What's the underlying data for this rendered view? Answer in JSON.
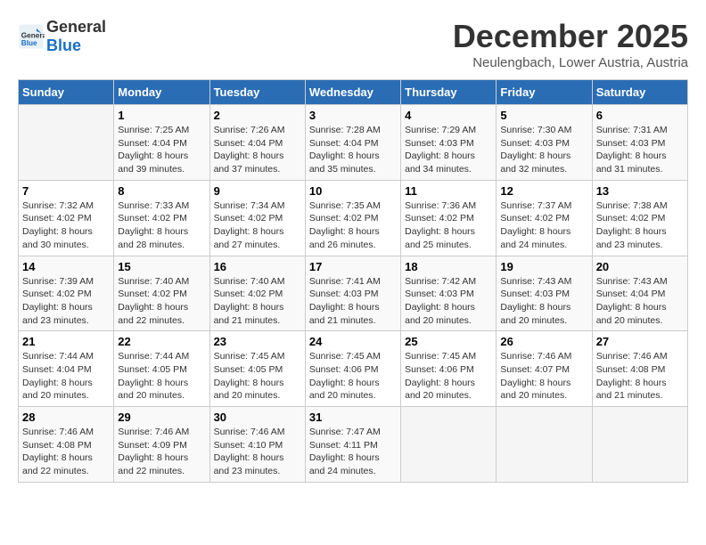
{
  "header": {
    "logo_general": "General",
    "logo_blue": "Blue",
    "month_title": "December 2025",
    "location": "Neulengbach, Lower Austria, Austria"
  },
  "days_of_week": [
    "Sunday",
    "Monday",
    "Tuesday",
    "Wednesday",
    "Thursday",
    "Friday",
    "Saturday"
  ],
  "weeks": [
    [
      {
        "day": "",
        "sunrise": "",
        "sunset": "",
        "daylight": ""
      },
      {
        "day": "1",
        "sunrise": "Sunrise: 7:25 AM",
        "sunset": "Sunset: 4:04 PM",
        "daylight": "Daylight: 8 hours and 39 minutes."
      },
      {
        "day": "2",
        "sunrise": "Sunrise: 7:26 AM",
        "sunset": "Sunset: 4:04 PM",
        "daylight": "Daylight: 8 hours and 37 minutes."
      },
      {
        "day": "3",
        "sunrise": "Sunrise: 7:28 AM",
        "sunset": "Sunset: 4:04 PM",
        "daylight": "Daylight: 8 hours and 35 minutes."
      },
      {
        "day": "4",
        "sunrise": "Sunrise: 7:29 AM",
        "sunset": "Sunset: 4:03 PM",
        "daylight": "Daylight: 8 hours and 34 minutes."
      },
      {
        "day": "5",
        "sunrise": "Sunrise: 7:30 AM",
        "sunset": "Sunset: 4:03 PM",
        "daylight": "Daylight: 8 hours and 32 minutes."
      },
      {
        "day": "6",
        "sunrise": "Sunrise: 7:31 AM",
        "sunset": "Sunset: 4:03 PM",
        "daylight": "Daylight: 8 hours and 31 minutes."
      }
    ],
    [
      {
        "day": "7",
        "sunrise": "Sunrise: 7:32 AM",
        "sunset": "Sunset: 4:02 PM",
        "daylight": "Daylight: 8 hours and 30 minutes."
      },
      {
        "day": "8",
        "sunrise": "Sunrise: 7:33 AM",
        "sunset": "Sunset: 4:02 PM",
        "daylight": "Daylight: 8 hours and 28 minutes."
      },
      {
        "day": "9",
        "sunrise": "Sunrise: 7:34 AM",
        "sunset": "Sunset: 4:02 PM",
        "daylight": "Daylight: 8 hours and 27 minutes."
      },
      {
        "day": "10",
        "sunrise": "Sunrise: 7:35 AM",
        "sunset": "Sunset: 4:02 PM",
        "daylight": "Daylight: 8 hours and 26 minutes."
      },
      {
        "day": "11",
        "sunrise": "Sunrise: 7:36 AM",
        "sunset": "Sunset: 4:02 PM",
        "daylight": "Daylight: 8 hours and 25 minutes."
      },
      {
        "day": "12",
        "sunrise": "Sunrise: 7:37 AM",
        "sunset": "Sunset: 4:02 PM",
        "daylight": "Daylight: 8 hours and 24 minutes."
      },
      {
        "day": "13",
        "sunrise": "Sunrise: 7:38 AM",
        "sunset": "Sunset: 4:02 PM",
        "daylight": "Daylight: 8 hours and 23 minutes."
      }
    ],
    [
      {
        "day": "14",
        "sunrise": "Sunrise: 7:39 AM",
        "sunset": "Sunset: 4:02 PM",
        "daylight": "Daylight: 8 hours and 23 minutes."
      },
      {
        "day": "15",
        "sunrise": "Sunrise: 7:40 AM",
        "sunset": "Sunset: 4:02 PM",
        "daylight": "Daylight: 8 hours and 22 minutes."
      },
      {
        "day": "16",
        "sunrise": "Sunrise: 7:40 AM",
        "sunset": "Sunset: 4:02 PM",
        "daylight": "Daylight: 8 hours and 21 minutes."
      },
      {
        "day": "17",
        "sunrise": "Sunrise: 7:41 AM",
        "sunset": "Sunset: 4:03 PM",
        "daylight": "Daylight: 8 hours and 21 minutes."
      },
      {
        "day": "18",
        "sunrise": "Sunrise: 7:42 AM",
        "sunset": "Sunset: 4:03 PM",
        "daylight": "Daylight: 8 hours and 20 minutes."
      },
      {
        "day": "19",
        "sunrise": "Sunrise: 7:43 AM",
        "sunset": "Sunset: 4:03 PM",
        "daylight": "Daylight: 8 hours and 20 minutes."
      },
      {
        "day": "20",
        "sunrise": "Sunrise: 7:43 AM",
        "sunset": "Sunset: 4:04 PM",
        "daylight": "Daylight: 8 hours and 20 minutes."
      }
    ],
    [
      {
        "day": "21",
        "sunrise": "Sunrise: 7:44 AM",
        "sunset": "Sunset: 4:04 PM",
        "daylight": "Daylight: 8 hours and 20 minutes."
      },
      {
        "day": "22",
        "sunrise": "Sunrise: 7:44 AM",
        "sunset": "Sunset: 4:05 PM",
        "daylight": "Daylight: 8 hours and 20 minutes."
      },
      {
        "day": "23",
        "sunrise": "Sunrise: 7:45 AM",
        "sunset": "Sunset: 4:05 PM",
        "daylight": "Daylight: 8 hours and 20 minutes."
      },
      {
        "day": "24",
        "sunrise": "Sunrise: 7:45 AM",
        "sunset": "Sunset: 4:06 PM",
        "daylight": "Daylight: 8 hours and 20 minutes."
      },
      {
        "day": "25",
        "sunrise": "Sunrise: 7:45 AM",
        "sunset": "Sunset: 4:06 PM",
        "daylight": "Daylight: 8 hours and 20 minutes."
      },
      {
        "day": "26",
        "sunrise": "Sunrise: 7:46 AM",
        "sunset": "Sunset: 4:07 PM",
        "daylight": "Daylight: 8 hours and 20 minutes."
      },
      {
        "day": "27",
        "sunrise": "Sunrise: 7:46 AM",
        "sunset": "Sunset: 4:08 PM",
        "daylight": "Daylight: 8 hours and 21 minutes."
      }
    ],
    [
      {
        "day": "28",
        "sunrise": "Sunrise: 7:46 AM",
        "sunset": "Sunset: 4:08 PM",
        "daylight": "Daylight: 8 hours and 22 minutes."
      },
      {
        "day": "29",
        "sunrise": "Sunrise: 7:46 AM",
        "sunset": "Sunset: 4:09 PM",
        "daylight": "Daylight: 8 hours and 22 minutes."
      },
      {
        "day": "30",
        "sunrise": "Sunrise: 7:46 AM",
        "sunset": "Sunset: 4:10 PM",
        "daylight": "Daylight: 8 hours and 23 minutes."
      },
      {
        "day": "31",
        "sunrise": "Sunrise: 7:47 AM",
        "sunset": "Sunset: 4:11 PM",
        "daylight": "Daylight: 8 hours and 24 minutes."
      },
      {
        "day": "",
        "sunrise": "",
        "sunset": "",
        "daylight": ""
      },
      {
        "day": "",
        "sunrise": "",
        "sunset": "",
        "daylight": ""
      },
      {
        "day": "",
        "sunrise": "",
        "sunset": "",
        "daylight": ""
      }
    ]
  ]
}
